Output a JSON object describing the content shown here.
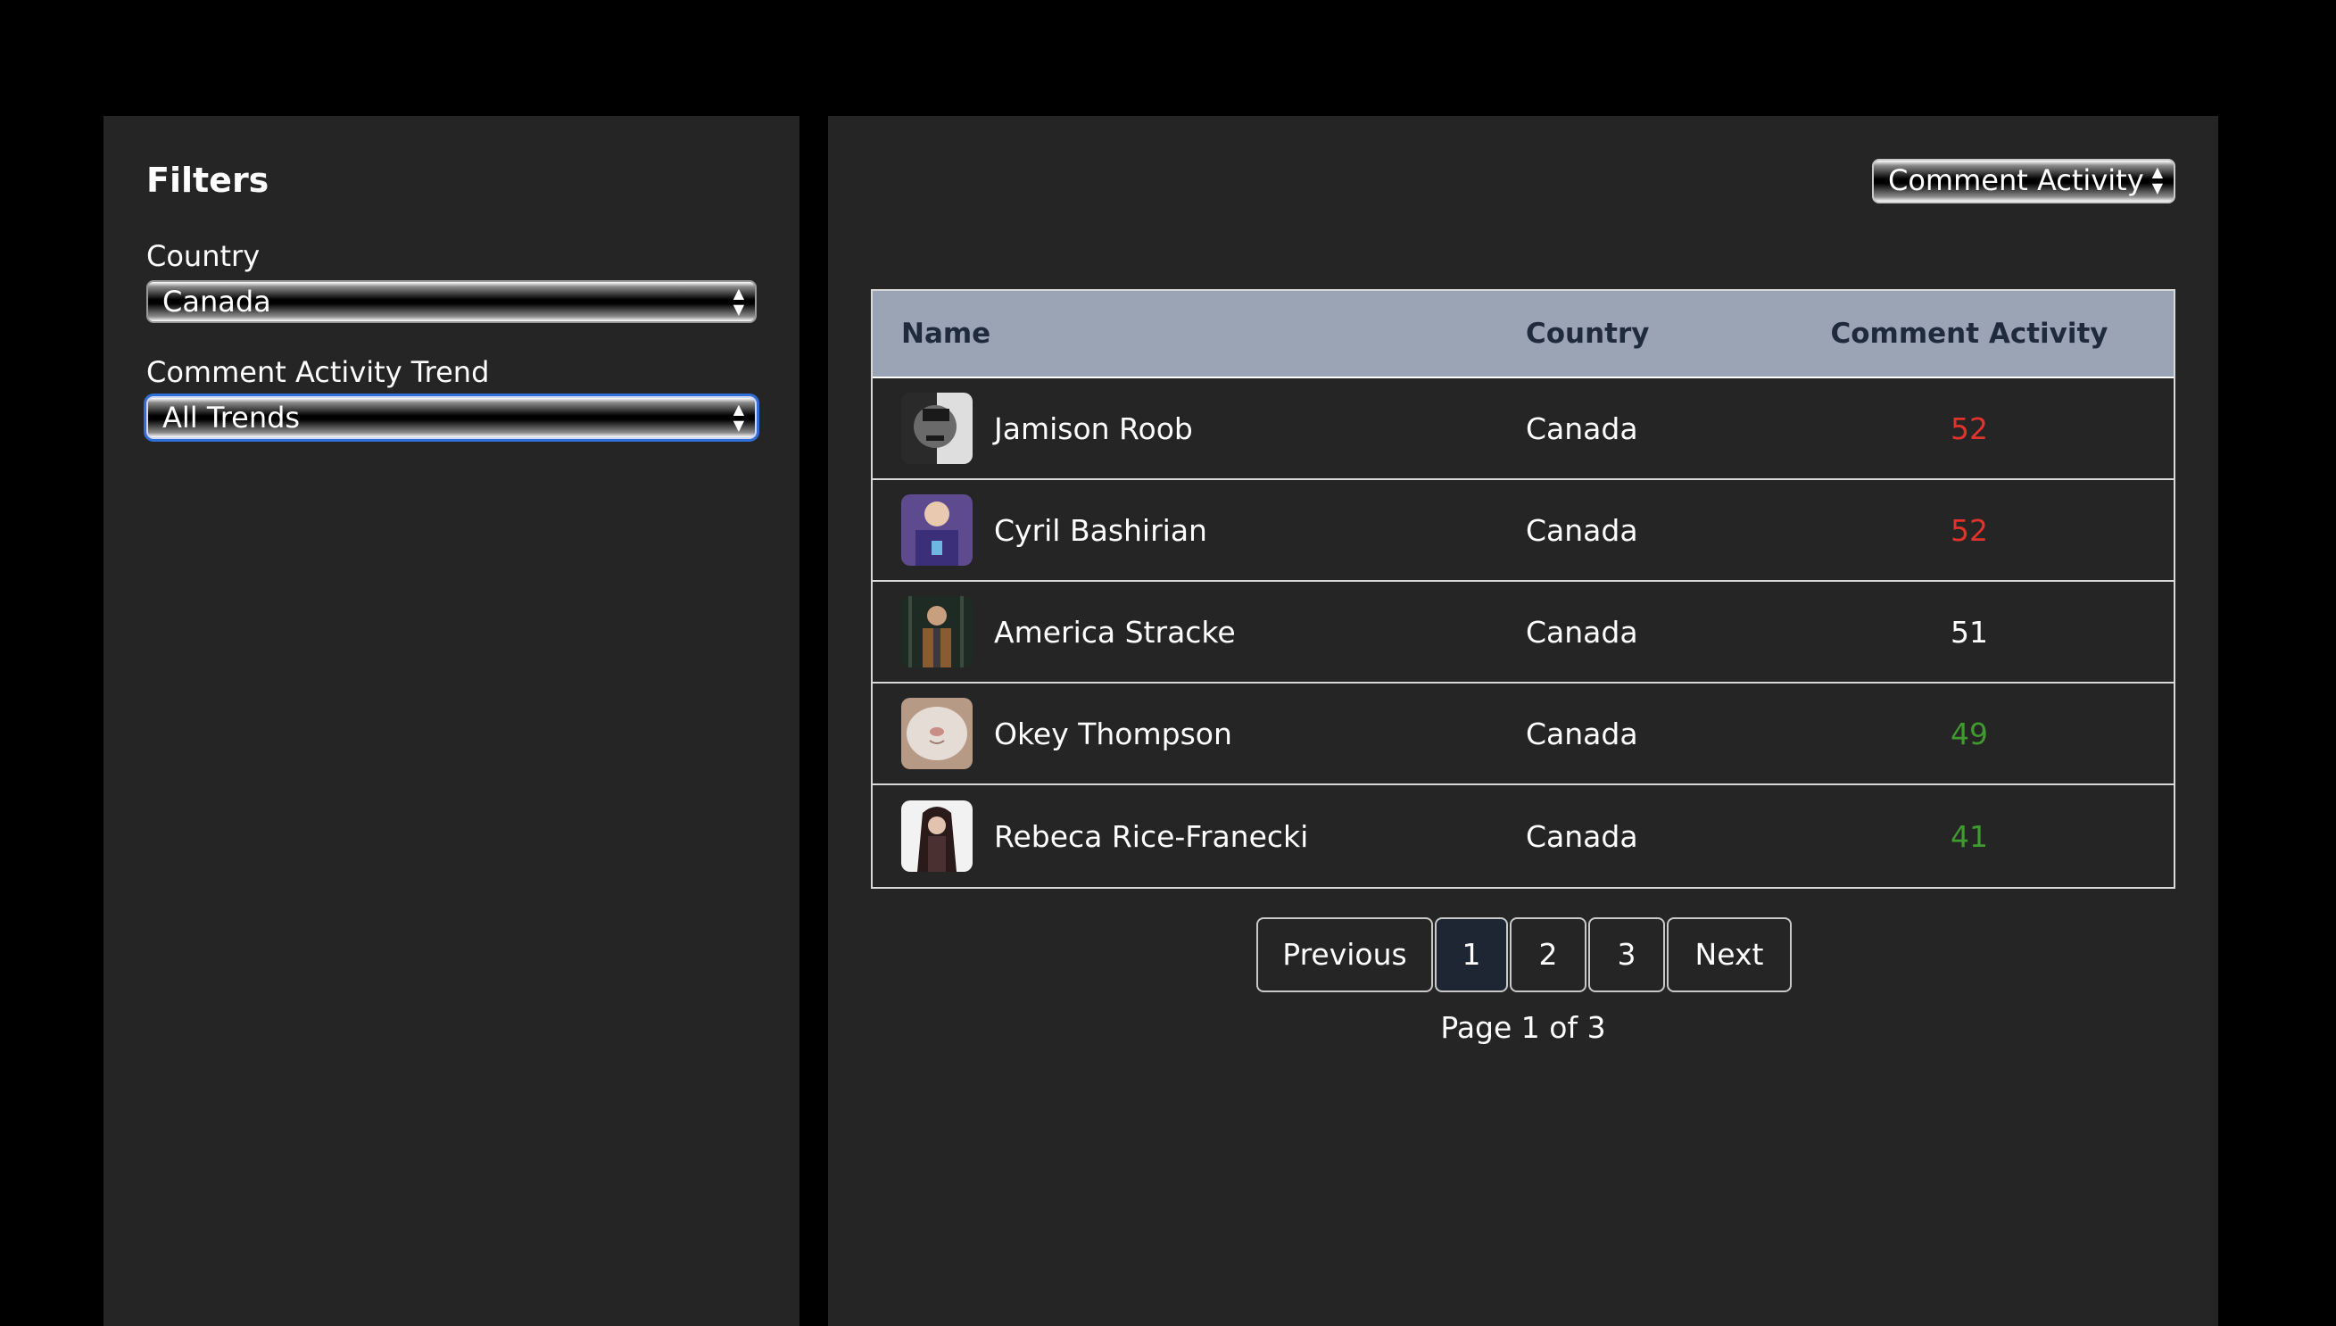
{
  "sidebar": {
    "title": "Filters",
    "country_label": "Country",
    "country_value": "Canada",
    "trend_label": "Comment Activity Trend",
    "trend_value": "All Trends"
  },
  "main": {
    "sort_select_value": "Comment Activity",
    "table": {
      "headers": {
        "name": "Name",
        "country": "Country",
        "activity": "Comment Activity"
      },
      "rows": [
        {
          "name": "Jamison Roob",
          "country": "Canada",
          "activity": "52",
          "activity_color": "#e0332b"
        },
        {
          "name": "Cyril Bashirian",
          "country": "Canada",
          "activity": "52",
          "activity_color": "#e0332b"
        },
        {
          "name": "America Stracke",
          "country": "Canada",
          "activity": "51",
          "activity_color": "#ffffff"
        },
        {
          "name": "Okey Thompson",
          "country": "Canada",
          "activity": "49",
          "activity_color": "#3f9a2f"
        },
        {
          "name": "Rebeca Rice-Franecki",
          "country": "Canada",
          "activity": "41",
          "activity_color": "#3f9a2f"
        }
      ]
    },
    "pagination": {
      "previous": "Previous",
      "pages": [
        "1",
        "2",
        "3"
      ],
      "next": "Next",
      "current_page": 1,
      "info": "Page 1 of 3"
    }
  }
}
